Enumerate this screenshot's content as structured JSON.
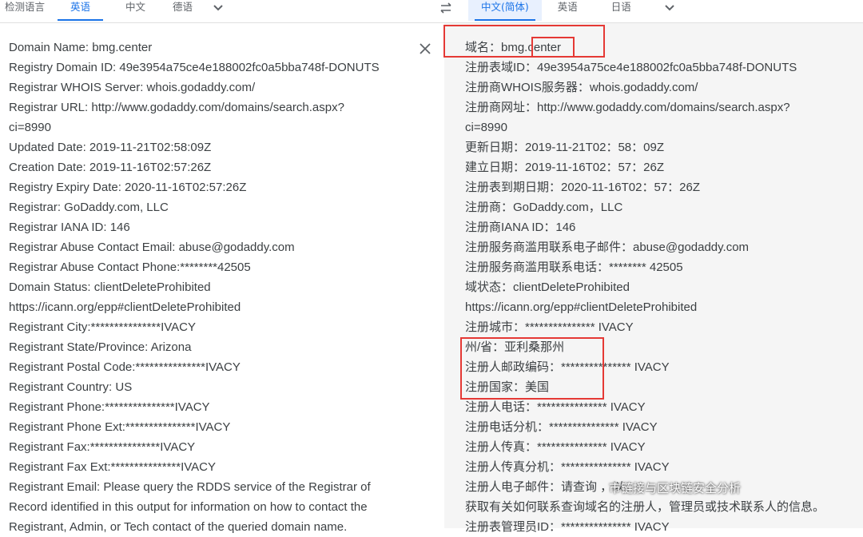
{
  "source_tabs": [
    "检测语言",
    "英语",
    "中文",
    "德语"
  ],
  "target_tabs": [
    "中文(简体)",
    "英语",
    "日语"
  ],
  "source_lines": [
    "Domain Name: bmg.center",
    "Registry Domain ID: 49e3954a75ce4e188002fc0a5bba748f-DONUTS",
    "Registrar WHOIS Server: whois.godaddy.com/",
    "Registrar URL: http://www.godaddy.com/domains/search.aspx?",
    "ci=8990",
    "Updated Date: 2019-11-21T02:58:09Z",
    "Creation Date: 2019-11-16T02:57:26Z",
    "Registry Expiry Date: 2020-11-16T02:57:26Z",
    "Registrar: GoDaddy.com, LLC",
    "Registrar IANA ID: 146",
    "Registrar Abuse Contact Email: abuse@godaddy.com",
    "Registrar Abuse Contact Phone:********42505",
    "Domain Status: clientDeleteProhibited",
    "https://icann.org/epp#clientDeleteProhibited",
    "Registrant City:***************IVACY",
    "Registrant State/Province: Arizona",
    "Registrant Postal Code:***************IVACY",
    "Registrant Country: US",
    "Registrant Phone:***************IVACY",
    "Registrant Phone Ext:***************IVACY",
    "Registrant Fax:***************IVACY",
    "Registrant Fax Ext:***************IVACY",
    "Registrant Email: Please query the RDDS service of the Registrar of",
    "Record identified in this output for information on how to contact the",
    "Registrant, Admin, or Tech contact of the queried domain name."
  ],
  "target_lines": [
    "域名：bmg.center",
    "注册表域ID：49e3954a75ce4e188002fc0a5bba748f-DONUTS",
    "注册商WHOIS服务器：whois.godaddy.com/",
    "注册商网址：http://www.godaddy.com/domains/search.aspx?",
    "ci=8990",
    "更新日期：2019-11-21T02：58：09Z",
    "建立日期：2019-11-16T02：57：26Z",
    "注册表到期日期：2020-11-16T02：57：26Z",
    "注册商：GoDaddy.com，LLC",
    "注册商IANA ID：146",
    "注册服务商滥用联系电子邮件：abuse@godaddy.com",
    "注册服务商滥用联系电话：******** 42505",
    "域状态：clientDeleteProhibited",
    "https://icann.org/epp#clientDeleteProhibited",
    "注册城市：*************** IVACY",
    "州/省：亚利桑那州",
    "注册人邮政编码：*************** IVACY",
    "注册国家：美国",
    "注册人电话：*************** IVACY",
    "注册电话分机：*************** IVACY",
    "注册人传真：*************** IVACY",
    "注册人传真分机：*************** IVACY",
    "注册人电子邮件：请查询                                      ，以",
    "获取有关如何联系查询域名的注册人，管理员或技术联系人的信息。",
    "注册表管理员ID：*************** IVACY"
  ],
  "watermark": "市链接与区块链安全分析",
  "colors": {
    "accent": "#1a73e8",
    "highlight_box": "#e53935",
    "right_pane_bg": "#f5f5f5"
  },
  "icons": {
    "swap": "swap-languages-icon",
    "close": "close-icon",
    "dropdown": "chevron-down-icon"
  }
}
